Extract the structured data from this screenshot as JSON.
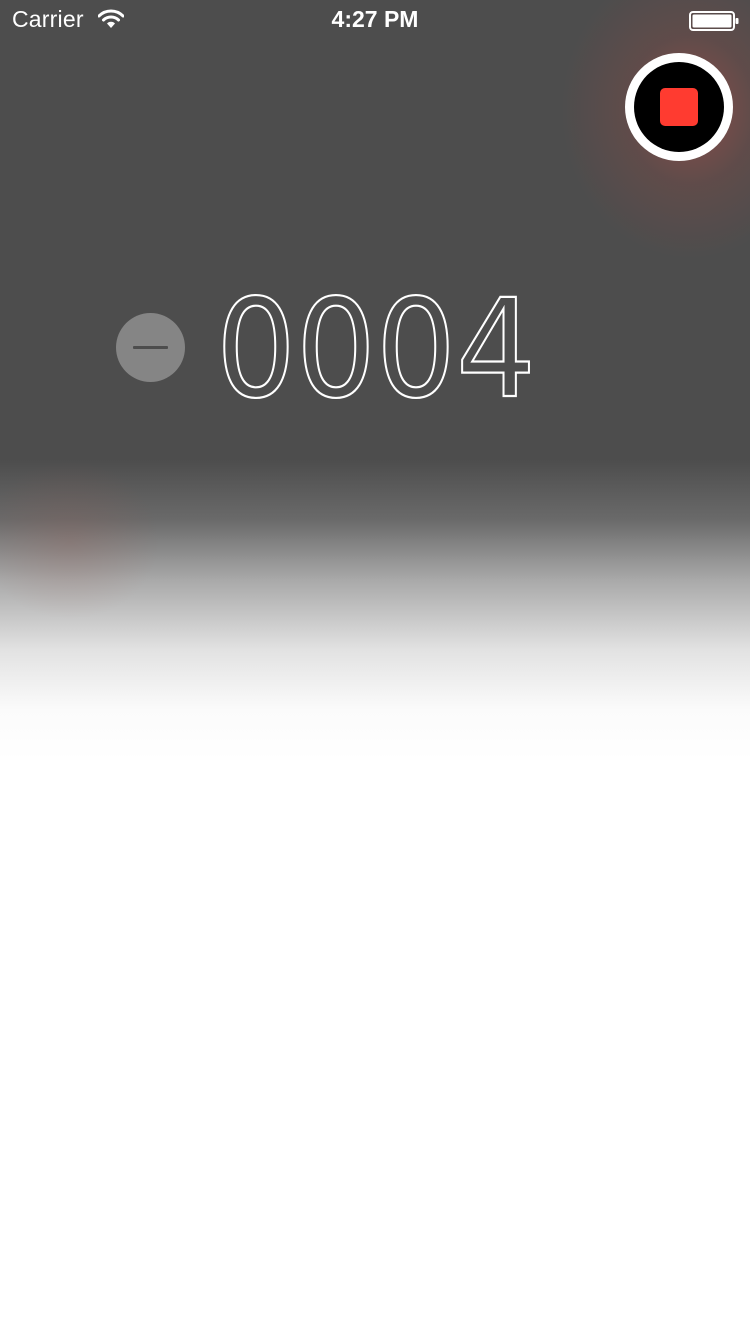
{
  "status_bar": {
    "carrier": "Carrier",
    "time": "4:27 PM",
    "icons": [
      "wifi-icon",
      "battery-icon"
    ]
  },
  "controls": {
    "stop_button_icon": "stop-icon",
    "decrement_button_icon": "minus-icon"
  },
  "counter": {
    "value": "0004"
  },
  "colors": {
    "stop_accent": "#ff3b30",
    "background_dark": "#4d4d4d",
    "background_light": "#ffffff"
  }
}
